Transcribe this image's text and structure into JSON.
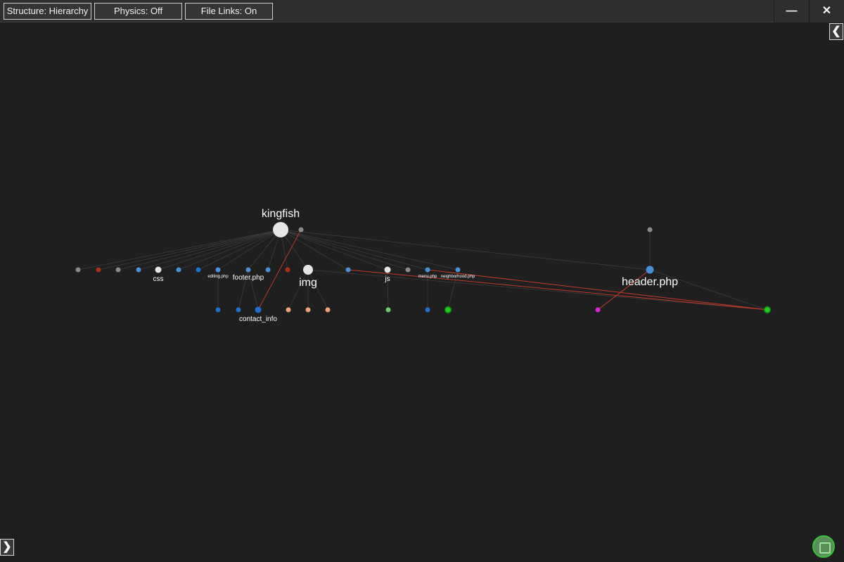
{
  "toolbar": {
    "structure_label": "Structure: Hierarchy",
    "physics_label": "Physics: Off",
    "file_links_label": "File Links: On"
  },
  "window": {
    "minimize_icon": "minimize-icon",
    "close_icon": "close-icon",
    "minimize_glyph": "—",
    "close_glyph": "✕"
  },
  "panels": {
    "right_toggle_glyph": "❮",
    "left_toggle_glyph": "❯"
  },
  "colors": {
    "background": "#1f1f1f",
    "edge": "#3b3b3b",
    "link_edge": "#c0392b",
    "folder": "#e6e6e6",
    "php": "#4a90d9",
    "blue": "#1f6fd1",
    "gray": "#8a8a8a",
    "dark_red": "#a83218",
    "peach": "#f2a37a",
    "light_green": "#6fcf6f",
    "green": "#22cc22",
    "magenta": "#e020e0"
  },
  "graph": {
    "nodes": [
      {
        "id": "kingfish",
        "label": "kingfish",
        "color": "#e6e6e6",
        "kind": "root-folder"
      },
      {
        "id": "root_file",
        "label": "",
        "color": "#8a8a8a",
        "kind": "file"
      },
      {
        "id": "r_gray1",
        "label": "",
        "color": "#8a8a8a",
        "kind": "file"
      },
      {
        "id": "r_red1",
        "label": "",
        "color": "#a83218",
        "kind": "file"
      },
      {
        "id": "r_gray2",
        "label": "",
        "color": "#8a8a8a",
        "kind": "file"
      },
      {
        "id": "r_blue1",
        "label": "",
        "color": "#4a90d9",
        "kind": "file"
      },
      {
        "id": "css",
        "label": "css",
        "color": "#e6e6e6",
        "kind": "folder"
      },
      {
        "id": "r_blue2",
        "label": "",
        "color": "#4a90d9",
        "kind": "file"
      },
      {
        "id": "r_blue3",
        "label": "",
        "color": "#1f6fd1",
        "kind": "file"
      },
      {
        "id": "editing",
        "label": "editing.php",
        "color": "#4a90d9",
        "kind": "file"
      },
      {
        "id": "footer",
        "label": "footer.php",
        "color": "#4a90d9",
        "kind": "file"
      },
      {
        "id": "r_blue4",
        "label": "",
        "color": "#4a90d9",
        "kind": "file"
      },
      {
        "id": "r_red2",
        "label": "",
        "color": "#a83218",
        "kind": "file"
      },
      {
        "id": "img",
        "label": "img",
        "color": "#e6e6e6",
        "kind": "folder"
      },
      {
        "id": "r_blue5",
        "label": "",
        "color": "#4a90d9",
        "kind": "file"
      },
      {
        "id": "js",
        "label": "js",
        "color": "#e6e6e6",
        "kind": "folder"
      },
      {
        "id": "r_gray3",
        "label": "",
        "color": "#8a8a8a",
        "kind": "file"
      },
      {
        "id": "menu",
        "label": "menu.php",
        "color": "#4a90d9",
        "kind": "file"
      },
      {
        "id": "neighborhood",
        "label": "neighborhood.php",
        "color": "#4a90d9",
        "kind": "file"
      },
      {
        "id": "hdr_parent",
        "label": "",
        "color": "#8a8a8a",
        "kind": "file"
      },
      {
        "id": "header",
        "label": "header.php",
        "color": "#4a90d9",
        "kind": "file"
      },
      {
        "id": "c_blue1",
        "label": "",
        "color": "#1f6fd1",
        "kind": "file"
      },
      {
        "id": "c_blue2",
        "label": "",
        "color": "#1f6fd1",
        "kind": "file"
      },
      {
        "id": "contact_info",
        "label": "contact_info",
        "color": "#1f6fd1",
        "kind": "file"
      },
      {
        "id": "img_a",
        "label": "",
        "color": "#f2a37a",
        "kind": "file"
      },
      {
        "id": "img_b",
        "label": "",
        "color": "#f2a37a",
        "kind": "file"
      },
      {
        "id": "img_c",
        "label": "",
        "color": "#f2a37a",
        "kind": "file"
      },
      {
        "id": "js_a",
        "label": "",
        "color": "#6fcf6f",
        "kind": "file"
      },
      {
        "id": "menu_a",
        "label": "",
        "color": "#1f6fd1",
        "kind": "file"
      },
      {
        "id": "nb_a",
        "label": "",
        "color": "#22cc22",
        "kind": "file"
      },
      {
        "id": "hdr_a",
        "label": "",
        "color": "#e020e0",
        "kind": "file"
      },
      {
        "id": "green_far",
        "label": "",
        "color": "#22cc22",
        "kind": "file"
      }
    ],
    "edges": [
      {
        "from": "kingfish",
        "to": "r_gray1",
        "type": "tree"
      },
      {
        "from": "kingfish",
        "to": "r_red1",
        "type": "tree"
      },
      {
        "from": "kingfish",
        "to": "r_gray2",
        "type": "tree"
      },
      {
        "from": "kingfish",
        "to": "r_blue1",
        "type": "tree"
      },
      {
        "from": "kingfish",
        "to": "css",
        "type": "tree"
      },
      {
        "from": "kingfish",
        "to": "r_blue2",
        "type": "tree"
      },
      {
        "from": "kingfish",
        "to": "r_blue3",
        "type": "tree"
      },
      {
        "from": "kingfish",
        "to": "editing",
        "type": "tree"
      },
      {
        "from": "kingfish",
        "to": "footer",
        "type": "tree"
      },
      {
        "from": "kingfish",
        "to": "r_blue4",
        "type": "tree"
      },
      {
        "from": "kingfish",
        "to": "r_red2",
        "type": "tree"
      },
      {
        "from": "kingfish",
        "to": "img",
        "type": "tree"
      },
      {
        "from": "kingfish",
        "to": "r_blue5",
        "type": "tree"
      },
      {
        "from": "kingfish",
        "to": "js",
        "type": "tree"
      },
      {
        "from": "kingfish",
        "to": "r_gray3",
        "type": "tree"
      },
      {
        "from": "kingfish",
        "to": "menu",
        "type": "tree"
      },
      {
        "from": "kingfish",
        "to": "neighborhood",
        "type": "tree"
      },
      {
        "from": "kingfish",
        "to": "header",
        "type": "tree"
      },
      {
        "from": "hdr_parent",
        "to": "header",
        "type": "tree"
      },
      {
        "from": "editing",
        "to": "c_blue1",
        "type": "tree"
      },
      {
        "from": "footer",
        "to": "c_blue2",
        "type": "tree"
      },
      {
        "from": "footer",
        "to": "contact_info",
        "type": "tree"
      },
      {
        "from": "img",
        "to": "img_a",
        "type": "tree"
      },
      {
        "from": "img",
        "to": "img_b",
        "type": "tree"
      },
      {
        "from": "img",
        "to": "img_c",
        "type": "tree"
      },
      {
        "from": "js",
        "to": "js_a",
        "type": "tree"
      },
      {
        "from": "menu",
        "to": "menu_a",
        "type": "tree"
      },
      {
        "from": "neighborhood",
        "to": "nb_a",
        "type": "tree"
      },
      {
        "from": "header",
        "to": "hdr_a",
        "type": "tree"
      },
      {
        "from": "header",
        "to": "green_far",
        "type": "tree"
      },
      {
        "from": "img",
        "to": "green_far",
        "type": "tree"
      },
      {
        "from": "root_file",
        "to": "contact_info",
        "type": "link"
      },
      {
        "from": "r_blue5",
        "to": "green_far",
        "type": "link"
      },
      {
        "from": "menu",
        "to": "green_far",
        "type": "link"
      },
      {
        "from": "header",
        "to": "hdr_a",
        "type": "link"
      }
    ]
  },
  "fit_button": {
    "icon": "fit-view-icon"
  }
}
